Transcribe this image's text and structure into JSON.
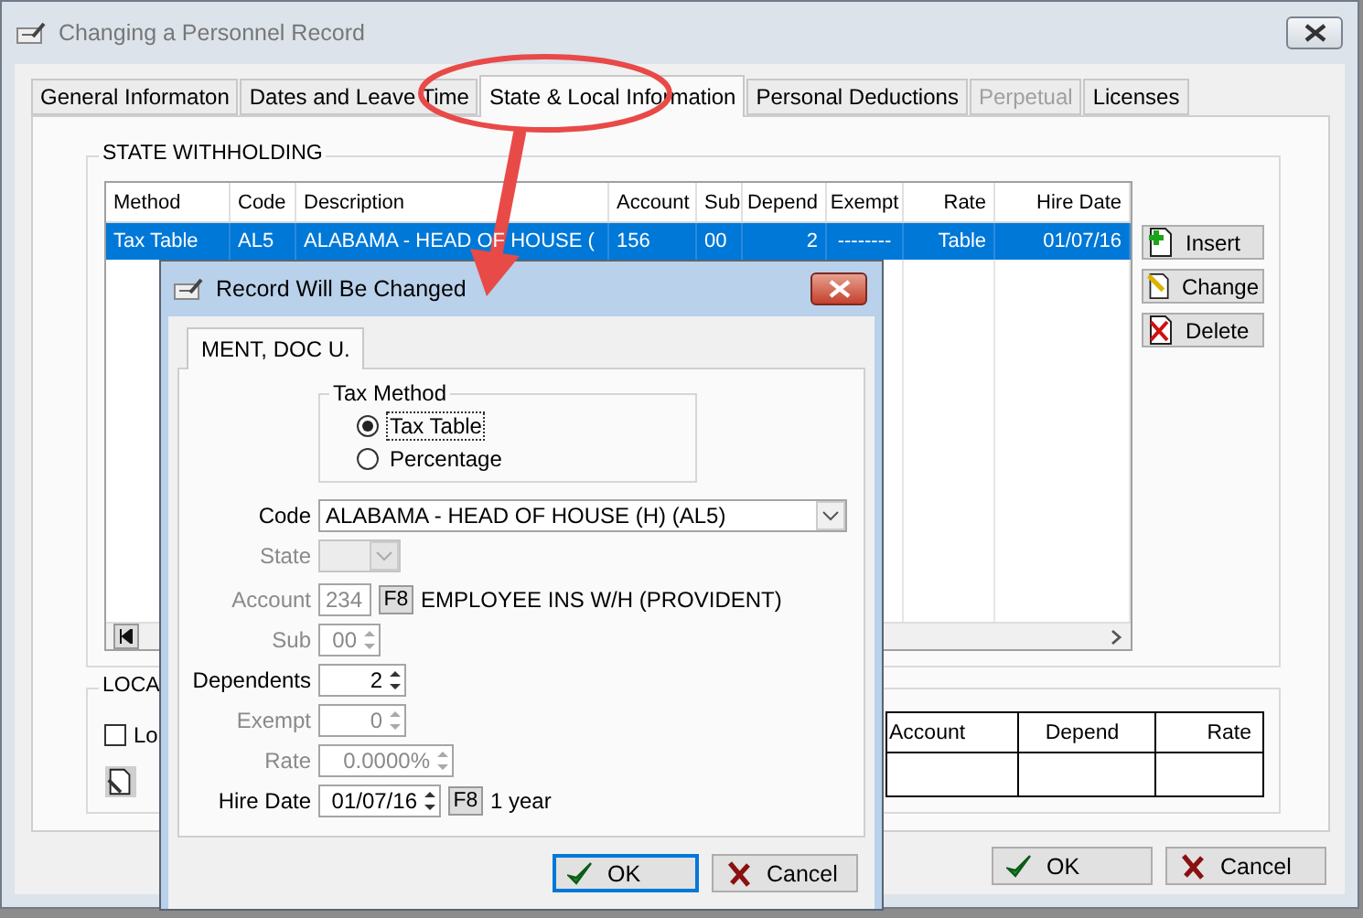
{
  "window": {
    "title": "Changing a Personnel Record"
  },
  "tabs": [
    {
      "label": "General Informaton",
      "selected": false,
      "disabled": false
    },
    {
      "label": "Dates and Leave Time",
      "selected": false,
      "disabled": false
    },
    {
      "label": "State & Local Information",
      "selected": true,
      "disabled": false
    },
    {
      "label": "Personal Deductions",
      "selected": false,
      "disabled": false
    },
    {
      "label": "Perpetual",
      "selected": false,
      "disabled": true
    },
    {
      "label": "Licenses",
      "selected": false,
      "disabled": false
    }
  ],
  "state_withholding": {
    "title": "STATE WITHHOLDING",
    "columns": [
      "Method",
      "Code",
      "Description",
      "Account",
      "Sub",
      "Depend",
      "Exempt",
      "Rate",
      "Hire Date"
    ],
    "rows": [
      {
        "selected": true,
        "cells": [
          "Tax Table",
          "AL5",
          "ALABAMA - HEAD OF HOUSE (",
          "156",
          "00",
          "2",
          "--------",
          "Table",
          "01/07/16"
        ]
      }
    ],
    "buttons": [
      {
        "kind": "insert",
        "label": "Insert"
      },
      {
        "kind": "change",
        "label": "Change"
      },
      {
        "kind": "delete",
        "label": "Delete"
      }
    ]
  },
  "local": {
    "title": "LOCA",
    "checkbox": {
      "label": "Lo",
      "checked": false
    },
    "columns": [
      "Account",
      "Depend",
      "Rate"
    ]
  },
  "buttons": [
    {
      "kind": "ok",
      "label": "OK",
      "default": false
    },
    {
      "kind": "cancel",
      "label": "Cancel",
      "default": false
    }
  ],
  "dialog": {
    "title": "Record Will Be Changed",
    "tab": "MENT, DOC U.",
    "tax_method": {
      "title": "Tax Method",
      "options": [
        {
          "label": "Tax Table",
          "selected": true
        },
        {
          "label": "Percentage",
          "selected": false
        }
      ]
    },
    "fields": [
      {
        "kind": "combo",
        "label": "Code",
        "value": "ALABAMA - HEAD OF HOUSE (H) (AL5)",
        "disabled": false
      },
      {
        "kind": "combo",
        "label": "State",
        "disabled": true
      },
      {
        "kind": "account",
        "label": "Account",
        "value": "234",
        "disabled": true,
        "lookup_key": "F8",
        "note": "EMPLOYEE INS W/H (PROVIDENT)"
      },
      {
        "kind": "spin",
        "label": "Sub",
        "value": "00",
        "disabled": true
      },
      {
        "kind": "spin",
        "label": "Dependents",
        "value": "2",
        "disabled": false
      },
      {
        "kind": "spin",
        "label": "Exempt",
        "value": "0",
        "disabled": true
      },
      {
        "kind": "spin",
        "label": "Rate",
        "value": "0.0000%",
        "disabled": true
      },
      {
        "kind": "spin",
        "label": "Hire Date",
        "value": "01/07/16",
        "disabled": false,
        "lookup_key": "F8",
        "note": "1 year"
      }
    ],
    "buttons": [
      {
        "kind": "ok",
        "label": "OK",
        "default": true
      },
      {
        "kind": "cancel",
        "label": "Cancel",
        "default": false
      }
    ]
  }
}
